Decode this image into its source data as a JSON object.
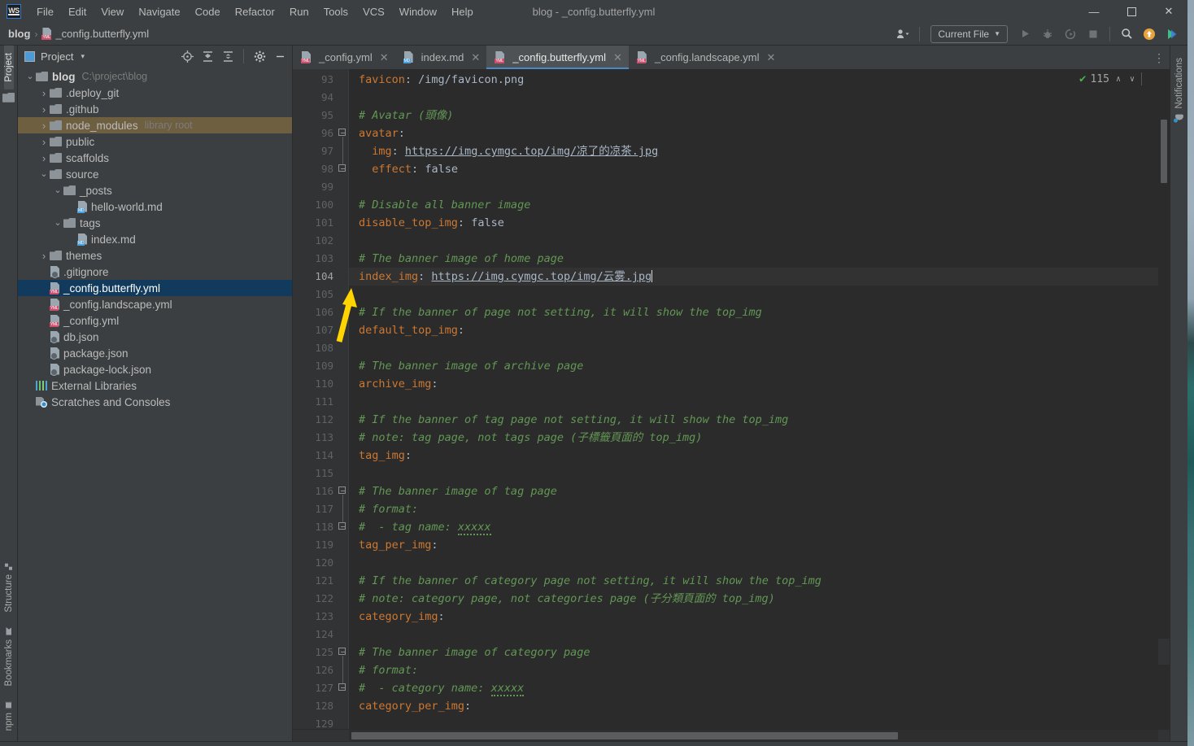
{
  "window": {
    "title": "blog - _config.butterfly.yml",
    "logo": "WS",
    "controls": {
      "minimize": "—",
      "maximize": "☐",
      "close": "✕"
    }
  },
  "menubar": {
    "items": [
      {
        "label": "File"
      },
      {
        "label": "Edit"
      },
      {
        "label": "View"
      },
      {
        "label": "Navigate"
      },
      {
        "label": "Code"
      },
      {
        "label": "Refactor"
      },
      {
        "label": "Run"
      },
      {
        "label": "Tools"
      },
      {
        "label": "VCS"
      },
      {
        "label": "Window"
      },
      {
        "label": "Help"
      }
    ]
  },
  "navbar": {
    "crumbs": [
      {
        "label": "blog",
        "icon": "none"
      },
      {
        "label": "_config.butterfly.yml",
        "icon": "yml-file-icon"
      }
    ],
    "separator": "›",
    "right": {
      "user_icon": "user-avatar-icon",
      "run_config": "Current File",
      "run_icon": "run-icon",
      "debug_icon": "debug-icon",
      "coverage_icon": "run-with-coverage-icon",
      "stop_icon": "stop-icon",
      "search_icon": "search-everywhere-icon",
      "update_icon": "update-available-icon",
      "ide_icon": "ide-features-trainer-icon"
    }
  },
  "leftbar": {
    "top": [
      {
        "label": "Project",
        "icon": "project-icon",
        "active": true
      }
    ],
    "bottom": [
      {
        "label": "Structure",
        "icon": "structure-icon"
      },
      {
        "label": "Bookmarks",
        "icon": "bookmarks-icon"
      },
      {
        "label": "npm",
        "icon": "npm-icon"
      }
    ]
  },
  "rightbar": {
    "items": [
      {
        "label": "Notifications",
        "icon": "notifications-bell-icon"
      }
    ]
  },
  "project_panel": {
    "title": "Project",
    "dropdown_caret": "▾",
    "toolbar": [
      {
        "name": "select-opened-file-icon",
        "glyph": "⊕"
      },
      {
        "name": "expand-all-icon",
        "glyph": "↧"
      },
      {
        "name": "collapse-all-icon",
        "glyph": "↥"
      },
      {
        "name": "settings-gear-icon",
        "glyph": "⚙"
      },
      {
        "name": "hide-panel-icon",
        "glyph": "—"
      }
    ],
    "tree": [
      {
        "label": "blog",
        "sub": "C:\\project\\blog",
        "depth": 0,
        "arrow": "expanded",
        "icon": "folder",
        "bold": true
      },
      {
        "label": ".deploy_git",
        "sub": "",
        "depth": 1,
        "arrow": "collapsed",
        "icon": "folder"
      },
      {
        "label": ".github",
        "sub": "",
        "depth": 1,
        "arrow": "collapsed",
        "icon": "folder"
      },
      {
        "label": "node_modules",
        "sub": "library root",
        "depth": 1,
        "arrow": "collapsed",
        "icon": "folder",
        "state": "library"
      },
      {
        "label": "public",
        "sub": "",
        "depth": 1,
        "arrow": "collapsed",
        "icon": "folder"
      },
      {
        "label": "scaffolds",
        "sub": "",
        "depth": 1,
        "arrow": "collapsed",
        "icon": "folder"
      },
      {
        "label": "source",
        "sub": "",
        "depth": 1,
        "arrow": "expanded",
        "icon": "folder"
      },
      {
        "label": "_posts",
        "sub": "",
        "depth": 2,
        "arrow": "expanded",
        "icon": "folder"
      },
      {
        "label": "hello-world.md",
        "sub": "",
        "depth": 3,
        "arrow": "none",
        "icon": "md"
      },
      {
        "label": "tags",
        "sub": "",
        "depth": 2,
        "arrow": "expanded",
        "icon": "folder"
      },
      {
        "label": "index.md",
        "sub": "",
        "depth": 3,
        "arrow": "none",
        "icon": "md"
      },
      {
        "label": "themes",
        "sub": "",
        "depth": 1,
        "arrow": "collapsed",
        "icon": "folder"
      },
      {
        "label": ".gitignore",
        "sub": "",
        "depth": 1,
        "arrow": "none",
        "icon": "git"
      },
      {
        "label": "_config.butterfly.yml",
        "sub": "",
        "depth": 1,
        "arrow": "none",
        "icon": "yml",
        "state": "selected"
      },
      {
        "label": "_config.landscape.yml",
        "sub": "",
        "depth": 1,
        "arrow": "none",
        "icon": "yml"
      },
      {
        "label": "_config.yml",
        "sub": "",
        "depth": 1,
        "arrow": "none",
        "icon": "yml"
      },
      {
        "label": "db.json",
        "sub": "",
        "depth": 1,
        "arrow": "none",
        "icon": "json"
      },
      {
        "label": "package.json",
        "sub": "",
        "depth": 1,
        "arrow": "none",
        "icon": "json"
      },
      {
        "label": "package-lock.json",
        "sub": "",
        "depth": 1,
        "arrow": "none",
        "icon": "json"
      },
      {
        "label": "External Libraries",
        "sub": "",
        "depth": 0,
        "arrow": "none",
        "icon": "libraries"
      },
      {
        "label": "Scratches and Consoles",
        "sub": "",
        "depth": 0,
        "arrow": "none",
        "icon": "scratches"
      }
    ]
  },
  "editor": {
    "tabs": [
      {
        "label": "_config.yml",
        "icon": "yml",
        "active": false,
        "close": "✕"
      },
      {
        "label": "index.md",
        "icon": "md",
        "active": false,
        "close": "✕"
      },
      {
        "label": "_config.butterfly.yml",
        "icon": "yml",
        "active": true,
        "close": "✕"
      },
      {
        "label": "_config.landscape.yml",
        "icon": "yml",
        "active": false,
        "close": "✕"
      }
    ],
    "tab_overflow_icon": "more-options-icon",
    "inspection": {
      "icon": "inspections-ok-icon",
      "count": "115",
      "prev": "∧",
      "next": "∨"
    },
    "first_line_number": 93,
    "current_line": 104,
    "lines": [
      {
        "n": 93,
        "tokens": [
          {
            "t": "key",
            "v": "favicon"
          },
          {
            "t": "pun",
            "v": ": "
          },
          {
            "t": "val",
            "v": "/img/favicon.png"
          }
        ]
      },
      {
        "n": 94,
        "tokens": []
      },
      {
        "n": 95,
        "tokens": [
          {
            "t": "cmt",
            "v": "# Avatar (頭像)"
          }
        ]
      },
      {
        "n": 96,
        "tokens": [
          {
            "t": "key",
            "v": "avatar"
          },
          {
            "t": "pun",
            "v": ":"
          }
        ],
        "fold": "start"
      },
      {
        "n": 97,
        "tokens": [
          {
            "t": "sp",
            "v": "  "
          },
          {
            "t": "key",
            "v": "img"
          },
          {
            "t": "pun",
            "v": ": "
          },
          {
            "t": "lnk",
            "v": "https://img.cymgc.top/img/凉了的凉茶.jpg"
          }
        ]
      },
      {
        "n": 98,
        "tokens": [
          {
            "t": "sp",
            "v": "  "
          },
          {
            "t": "key",
            "v": "effect"
          },
          {
            "t": "pun",
            "v": ": "
          },
          {
            "t": "val",
            "v": "false"
          }
        ],
        "fold": "end"
      },
      {
        "n": 99,
        "tokens": []
      },
      {
        "n": 100,
        "tokens": [
          {
            "t": "cmt",
            "v": "# Disable all banner image"
          }
        ]
      },
      {
        "n": 101,
        "tokens": [
          {
            "t": "key",
            "v": "disable_top_img"
          },
          {
            "t": "pun",
            "v": ": "
          },
          {
            "t": "val",
            "v": "false"
          }
        ]
      },
      {
        "n": 102,
        "tokens": []
      },
      {
        "n": 103,
        "tokens": [
          {
            "t": "cmt",
            "v": "# The banner image of home page"
          }
        ]
      },
      {
        "n": 104,
        "tokens": [
          {
            "t": "key",
            "v": "index_img"
          },
          {
            "t": "pun",
            "v": ": "
          },
          {
            "t": "lnk",
            "v": "https://img.cymgc.top/img/云雾.jpg"
          },
          {
            "t": "caret",
            "v": ""
          }
        ]
      },
      {
        "n": 105,
        "tokens": []
      },
      {
        "n": 106,
        "tokens": [
          {
            "t": "cmt",
            "v": "# If the banner of page not setting, it will show the top_img"
          }
        ]
      },
      {
        "n": 107,
        "tokens": [
          {
            "t": "key",
            "v": "default_top_img"
          },
          {
            "t": "pun",
            "v": ":"
          }
        ]
      },
      {
        "n": 108,
        "tokens": []
      },
      {
        "n": 109,
        "tokens": [
          {
            "t": "cmt",
            "v": "# The banner image of archive page"
          }
        ]
      },
      {
        "n": 110,
        "tokens": [
          {
            "t": "key",
            "v": "archive_img"
          },
          {
            "t": "pun",
            "v": ":"
          }
        ]
      },
      {
        "n": 111,
        "tokens": []
      },
      {
        "n": 112,
        "tokens": [
          {
            "t": "cmt",
            "v": "# If the banner of tag page not setting, it will show the top_img"
          }
        ]
      },
      {
        "n": 113,
        "tokens": [
          {
            "t": "cmt",
            "v": "# note: tag page, not tags page (子標籤頁面的 top_img)"
          }
        ]
      },
      {
        "n": 114,
        "tokens": [
          {
            "t": "key",
            "v": "tag_img"
          },
          {
            "t": "pun",
            "v": ":"
          }
        ]
      },
      {
        "n": 115,
        "tokens": []
      },
      {
        "n": 116,
        "tokens": [
          {
            "t": "cmt",
            "v": "# The banner image of tag page"
          }
        ],
        "fold": "start"
      },
      {
        "n": 117,
        "tokens": [
          {
            "t": "cmt",
            "v": "# format:"
          }
        ]
      },
      {
        "n": 118,
        "tokens": [
          {
            "t": "cmt",
            "v": "#  - tag name: "
          },
          {
            "t": "typo",
            "v": "xxxxx"
          }
        ],
        "fold": "end"
      },
      {
        "n": 119,
        "tokens": [
          {
            "t": "key",
            "v": "tag_per_img"
          },
          {
            "t": "pun",
            "v": ":"
          }
        ]
      },
      {
        "n": 120,
        "tokens": []
      },
      {
        "n": 121,
        "tokens": [
          {
            "t": "cmt",
            "v": "# If the banner of category page not setting, it will show the top_img"
          }
        ]
      },
      {
        "n": 122,
        "tokens": [
          {
            "t": "cmt",
            "v": "# note: category page, not categories page (子分類頁面的 top_img)"
          }
        ]
      },
      {
        "n": 123,
        "tokens": [
          {
            "t": "key",
            "v": "category_img"
          },
          {
            "t": "pun",
            "v": ":"
          }
        ]
      },
      {
        "n": 124,
        "tokens": []
      },
      {
        "n": 125,
        "tokens": [
          {
            "t": "cmt",
            "v": "# The banner image of category page"
          }
        ],
        "fold": "start"
      },
      {
        "n": 126,
        "tokens": [
          {
            "t": "cmt",
            "v": "# format:"
          }
        ]
      },
      {
        "n": 127,
        "tokens": [
          {
            "t": "cmt",
            "v": "#  - category name: "
          },
          {
            "t": "typo",
            "v": "xxxxx"
          }
        ],
        "fold": "end"
      },
      {
        "n": 128,
        "tokens": [
          {
            "t": "key",
            "v": "category_per_img"
          },
          {
            "t": "pun",
            "v": ":"
          }
        ]
      },
      {
        "n": 129,
        "tokens": []
      }
    ]
  },
  "annotation": {
    "type": "arrow",
    "color": "#ffd400",
    "points_to_line": 104
  },
  "colors": {
    "background": "#3c3f41",
    "editor_background": "#2b2b2b",
    "gutter_background": "#313335",
    "accent": "#4a88c7",
    "selection": "#113a5c",
    "library_row": "#6e5f41",
    "comment": "#629755",
    "keyword": "#cc7832",
    "text": "#a9b7c6",
    "annotation_arrow": "#ffd400"
  }
}
